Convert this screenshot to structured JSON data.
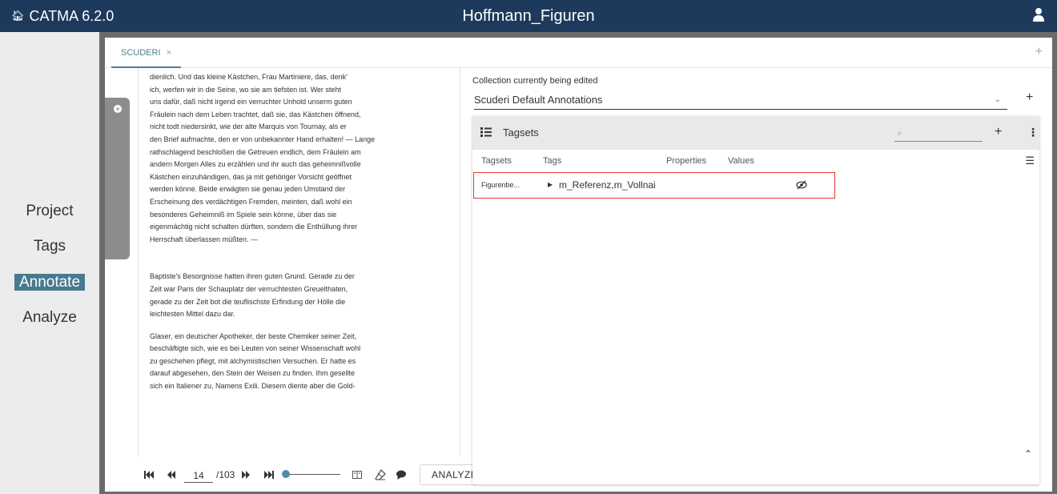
{
  "header": {
    "brand": "CATMA 6.2.0",
    "title": "Hoffmann_Figuren"
  },
  "nav": {
    "items": [
      {
        "label": "Project"
      },
      {
        "label": "Tags"
      },
      {
        "label": "Annotate"
      },
      {
        "label": "Analyze"
      }
    ],
    "active": "Annotate"
  },
  "tabs": [
    {
      "label": "SCUDERI",
      "close": "×"
    }
  ],
  "tab_add": "+",
  "document": {
    "lines_a": [
      "dienlich. Und das kleine Kästchen, Frau Martiniere, das, denk'",
      "ich, werfen wir in die Seine, wo sie am tiefsten ist. Wer steht",
      "uns dafür, daß nicht irgend ein verruchter Unhold unserm guten",
      "Fräulein nach dem Leben trachtet, daß sie, das Kästchen öffnend,",
      "nicht todt niedersinkt, wie der alte Marquis von Tournay, als er",
      "den Brief aufmachte, den er von unbekannter Hand erhalten! — Lange",
      "rathschlagend beschloßen die Getreuen endlich, dem Fräulein am",
      "andern Morgen Alles zu erzählen und ihr auch das geheimnißvolle",
      "Kästchen einzuhändigen, das ja mit gehöriger Vorsicht geöffnet",
      "werden könne. Beide erwägten sie genau jeden Umstand der",
      "Erscheinung des verdächtigen Fremden, meinten, daß wohl ein",
      "besonderes Geheimniß im Spiele sein könne, über das sie",
      "eigenmächtig nicht schalten dürften, sondern die Enthüllung ihrer",
      "Herrschaft überlassen müßten. —"
    ],
    "lines_b": [
      "Baptiste's Besorgnisse hatten ihren guten Grund. Gerade zu der",
      "Zeit war Paris der Schauplatz der verruchtesten Greuelthaten,",
      "gerade zu der Zeit bot die teuflischste Erfindung der Hölle die",
      "leichtesten Mittel dazu dar."
    ],
    "lines_c": [
      "Glaser, ein deutscher Apotheker, der beste Chemiker seiner Zeit,",
      "beschäftigte sich, wie es bei Leuten von seiner Wissenschaft wohl",
      "zu geschehen pflegt, mit alchymistischen Versuchen. Er hatte es",
      "darauf abgesehen, den Stein der Weisen zu finden. Ihm gesellte",
      "sich ein Italiener zu, Namens Exili. Diesem diente aber die Gold-"
    ]
  },
  "pager": {
    "current_page": "14",
    "total_label": "/103",
    "first_icon": "first-page-icon",
    "prev_icon": "previous-page-icon",
    "next_icon": "next-page-icon",
    "last_icon": "last-page-icon",
    "slider_level": 0.05
  },
  "toolbar": {
    "analyze_label": "ANALYZE"
  },
  "collection": {
    "label": "Collection currently being edited",
    "selected": "Scuderi Default Annotations"
  },
  "tagsets": {
    "title": "Tagsets",
    "search_placeholder": "⌕",
    "columns": [
      "Tagsets",
      "Tags",
      "Properties",
      "Values"
    ],
    "rows": [
      {
        "tagset": "Figurenbe...",
        "tags": "m_Referenz,m_Vollnai",
        "properties": "",
        "values": ""
      }
    ]
  },
  "colors": {
    "header_bg": "#1d3a5c",
    "active_nav": "#477a8e",
    "accent": "#4c7f94",
    "highlight_border": "#e53935"
  }
}
